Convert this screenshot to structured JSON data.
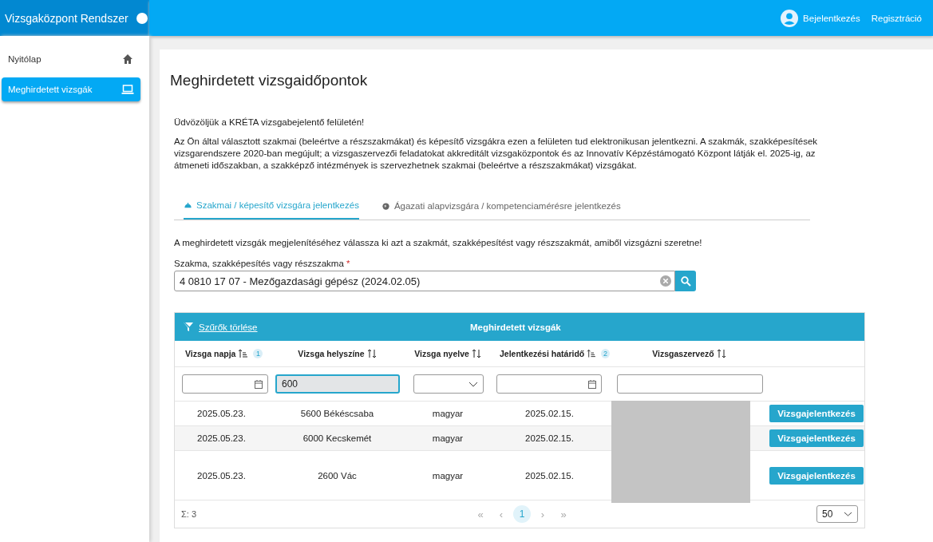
{
  "app_title": "Vizsgaközpont Rendszer",
  "header_links": [
    {
      "label": "Bejelentkezés"
    },
    {
      "label": "Regisztráció"
    }
  ],
  "sidebar": {
    "items": [
      {
        "label": "Nyitólap",
        "selected": false
      },
      {
        "label": "Meghirdetett vizsgák",
        "selected": true
      }
    ]
  },
  "page_title": "Meghirdetett vizsgaidőpontok",
  "intro": [
    "Üdvözöljük a KRÉTA vizsgabejelentő felületén!",
    "Az Ön által választott szakmai (beleértve a részszakmákat) és képesítő vizsgákra ezen a felületen tud elektronikusan jelentkezni. A szakmák, szakképesítések vizsgarendszere 2020-ban megújult; a vizsgaszervezői feladatokat akkreditált vizsgaközpontok és az Innovatív Képzéstámogató Központ látják el. 2025-ig, az átmeneti időszakban, a szakképző intézmények is szervezhetnek szakmai (beleértve a részszakmákat) vizsgákat."
  ],
  "tabs": [
    {
      "label": "Szakmai / képesítő vizsgára jelentkezés",
      "selected": true
    },
    {
      "label": "Ágazati alapvizsgára / kompetenciamérésre jelentkezés",
      "selected": false
    }
  ],
  "instruction": "A meghirdetett vizsgák megjelenítéséhez válassza ki azt a szakmát, szakképesítést vagy részszakmát, amiből vizsgázni szeretne!",
  "profession_field": {
    "label": "Szakma, szakképesítés vagy részszakma",
    "required_mark": "*",
    "value": "4 0810 17 07 - Mezőgazdasági gépész (2024.02.05)"
  },
  "table": {
    "clear_filters": "Szűrők törlése",
    "title": "Meghirdetett vizsgák",
    "columns": [
      {
        "label": "Vizsga napja",
        "sorted": true,
        "sort_order": "1",
        "filter": {
          "kind": "date",
          "focused": false
        }
      },
      {
        "label": "Vizsga helyszíne",
        "sorted": false,
        "filter": {
          "kind": "text",
          "value": "600",
          "focused": true
        }
      },
      {
        "label": "Vizsga nyelve",
        "sorted": false,
        "filter": {
          "kind": "select",
          "focused": false
        }
      },
      {
        "label": "Jelentkezési határidő",
        "sorted": true,
        "sort_order": "2",
        "filter": {
          "kind": "date",
          "focused": false
        }
      },
      {
        "label": "Vizsgaszervező",
        "sorted": false,
        "filter": {
          "kind": "text",
          "focused": false
        }
      }
    ],
    "rows": [
      {
        "cells": [
          "2025.05.23.",
          "5600 Békéscsaba",
          "magyar",
          "2025.02.15."
        ],
        "action": "Vizsgajelentkezés"
      },
      {
        "cells": [
          "2025.05.23.",
          "6000 Kecskemét",
          "magyar",
          "2025.02.15."
        ],
        "action": "Vizsgajelentkezés"
      },
      {
        "cells": [
          "2025.05.23.",
          "2600 Vác",
          "magyar",
          "2025.02.15."
        ],
        "action": "Vizsgajelentkezés"
      }
    ],
    "total": "Σ: 3",
    "pager": [
      {
        "label": "«",
        "kind": "nav",
        "selected": false
      },
      {
        "label": "‹",
        "kind": "nav",
        "selected": false
      },
      {
        "label": "1",
        "kind": "page",
        "selected": true
      },
      {
        "label": "›",
        "kind": "nav",
        "selected": false
      },
      {
        "label": "»",
        "kind": "nav",
        "selected": false
      }
    ],
    "page_size": "50"
  }
}
